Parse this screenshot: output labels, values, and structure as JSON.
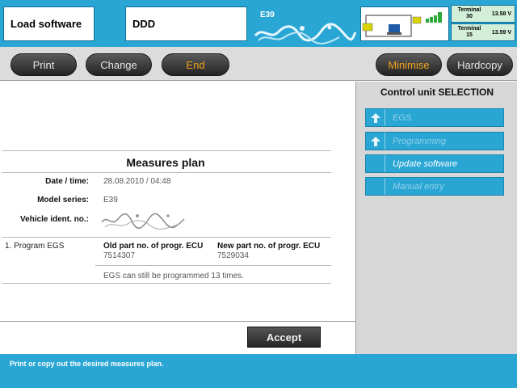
{
  "header": {
    "app_title": "Load software",
    "device": "DDD",
    "model": "E39",
    "terminals": [
      {
        "label": "Terminal 30",
        "voltage": "13.58 V"
      },
      {
        "label": "Terminal 15",
        "voltage": "13.59 V"
      }
    ]
  },
  "toolbar": {
    "print": "Print",
    "change": "Change",
    "end": "End",
    "minimise": "Minimise",
    "hardcopy": "Hardcopy"
  },
  "plan": {
    "title": "Measures plan",
    "date_label": "Date / time:",
    "date_value": "28.08.2010 / 04:48",
    "model_label": "Model series:",
    "model_value": "E39",
    "vin_label": "Vehicle ident. no.:",
    "program_label": "1. Program EGS",
    "old_part_header": "Old part no. of progr. ECU",
    "old_part_value": "7514307",
    "new_part_header": "New part no. of progr. ECU",
    "new_part_value": "7529034",
    "note": "EGS can still be programmed 13 times."
  },
  "accept_label": "Accept",
  "side": {
    "title": "Control unit SELECTION",
    "items": [
      {
        "label": "EGS"
      },
      {
        "label": "Programming"
      },
      {
        "label": "Update software"
      },
      {
        "label": "Manual entry"
      }
    ]
  },
  "status_text": "Print or copy out the desired measures plan.",
  "colors": {
    "accent": "#2aa6d4",
    "orange": "#f2a21c",
    "toolbar": "#dcdcdc",
    "side": "#d7d7d7"
  }
}
